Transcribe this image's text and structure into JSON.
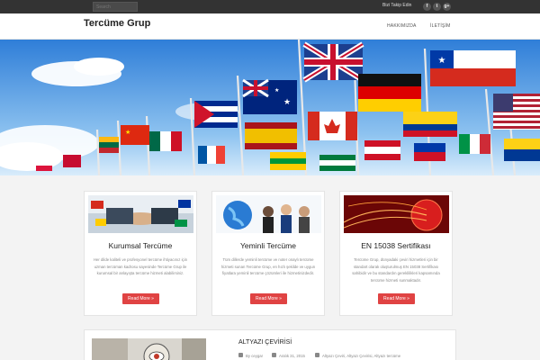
{
  "topbar": {
    "search_placeholder": "Search",
    "follow_label": "Bizi Takip Edin",
    "social": [
      {
        "icon": "facebook-icon",
        "glyph": "f"
      },
      {
        "icon": "twitter-icon",
        "glyph": "t"
      },
      {
        "icon": "google-plus-icon",
        "glyph": "g+"
      }
    ]
  },
  "header": {
    "logo": "Tercüme Grup",
    "nav": [
      "HAKKIMIZDA",
      "İLETİŞİM"
    ]
  },
  "cards": [
    {
      "title": "Kurumsal Tercüme",
      "text": "Her dilde kaliteli ve profesyonel tercüme ihtiyacınız için uzman tercüman kadrosu sayesinde Tercüme Grup ile kurumsal bir anlayışta tercüme hizmeti alabilirsiniz.",
      "button": "Read More »"
    },
    {
      "title": "Yeminli Tercüme",
      "text": "Tüm dillerde yeminli tercüme ve noter onaylı tercüme hizmeti sunan Tercüme Grup, en hızlı şekilde ve uygun fiyatlara yeminli tercüme çözümleri ile hizmetinizdedir.",
      "button": "Read More »"
    },
    {
      "title": "EN 15038 Sertifikası",
      "text": "Tercüme Grup, dünyadaki çeviri hizmetleri için bir standart olarak oluşturulmuş EN 15038 Sertifikası sahibidir ve bu standardın gereklilikleri kapsamında tercüme hizmeti sunmaktadır.",
      "button": "Read More »"
    }
  ],
  "post": {
    "title": "ALTYAZI ÇEVİRİSİ",
    "author": "By ceygar",
    "date": "Aralık 31, 2015",
    "categories": "Altyazı Çeviri, Altyazı Çevirisi, Altyazı tercüme"
  },
  "colors": {
    "accent": "#e04343",
    "topbar": "#333333"
  }
}
